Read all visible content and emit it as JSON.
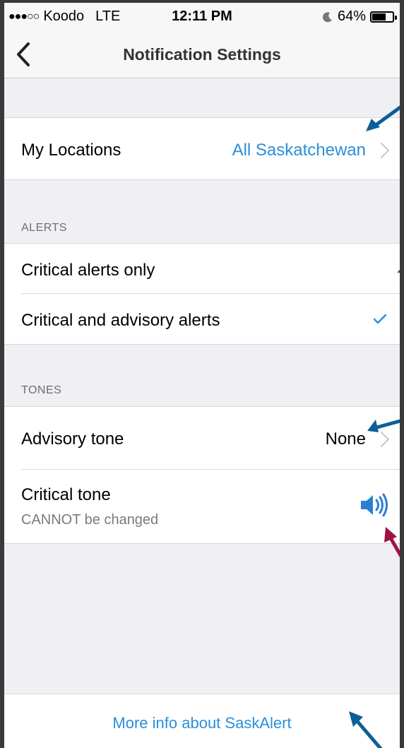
{
  "status_bar": {
    "carrier": "Koodo",
    "network": "LTE",
    "time": "12:11 PM",
    "battery": "64%",
    "signal_dots": "●●●○○"
  },
  "nav": {
    "title": "Notification Settings",
    "back_icon": "chevron-left-icon"
  },
  "locations": {
    "label": "My Locations",
    "value": "All Saskatchewan"
  },
  "alerts": {
    "header": "ALERTS",
    "options": [
      {
        "label": "Critical alerts only",
        "selected": false
      },
      {
        "label": "Critical and advisory alerts",
        "selected": true
      }
    ]
  },
  "tones": {
    "header": "TONES",
    "advisory": {
      "label": "Advisory tone",
      "value": "None"
    },
    "critical": {
      "label": "Critical tone",
      "sublabel": "CANNOT be changed",
      "icon": "speaker-icon"
    }
  },
  "footer": {
    "link": "More info about SaskAlert"
  },
  "colors": {
    "accent": "#2a8fdb",
    "annotation_arrow_blue": "#0b5f97",
    "annotation_arrow_red": "#a0123f"
  }
}
